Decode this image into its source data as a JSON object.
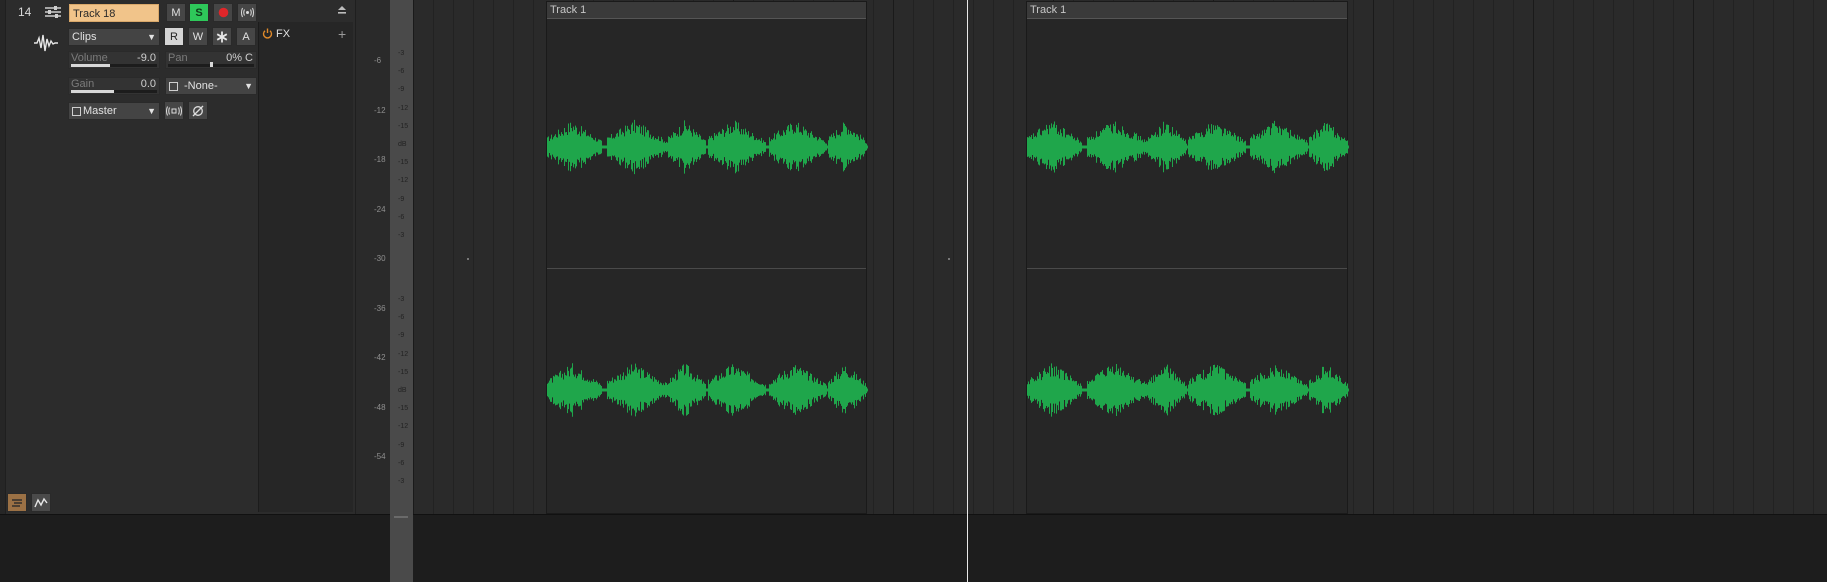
{
  "track": {
    "number": "14",
    "name": "Track 18",
    "mute_label": "M",
    "solo_label": "S",
    "read_label": "R",
    "write_label": "W",
    "auto_label": "A",
    "clips_dropdown": "Clips",
    "volume": {
      "label": "Volume",
      "value": "-9.0",
      "level": 0.45
    },
    "pan": {
      "label": "Pan",
      "value": "0% C",
      "level": 0.5
    },
    "gain": {
      "label": "Gain",
      "value": "0.0",
      "level": 0.5
    },
    "input": "-None-",
    "output": "Master",
    "fx_label": "FX",
    "fx_add": "+"
  },
  "meter_scale": [
    "-6",
    "-12",
    "-18",
    "-24",
    "-30",
    "-36",
    "-42",
    "-48",
    "-54"
  ],
  "db_labels_top": [
    "-3",
    "-6",
    "-9",
    "-12",
    "-15",
    "dB",
    "-15",
    "-12",
    "-9",
    "-6",
    "-3"
  ],
  "db_labels_bottom": [
    "-3",
    "-6",
    "-9",
    "-12",
    "-15",
    "dB",
    "-15",
    "-12",
    "-9",
    "-6",
    "-3"
  ],
  "clips": [
    {
      "title": "Track 1"
    },
    {
      "title": "Track 1"
    }
  ],
  "colors": {
    "track_name_bg": "#f1c48a",
    "solo_active": "#2ec85a",
    "record": "#e0262a",
    "waveform": "#1fa64b",
    "track_view_active": "#9b7145"
  },
  "icons": {
    "mixer": "mixer-sliders-icon",
    "waveform": "waveform-icon",
    "record": "record-dot-icon",
    "echo": "speaker-waves-icon",
    "snapshot": "asterisk-icon",
    "fx_power": "power-icon",
    "monitor": "input-monitor-icon",
    "phase": "phase-invert-icon",
    "track_view": "track-view-icon",
    "automation_view": "automation-lane-icon"
  }
}
